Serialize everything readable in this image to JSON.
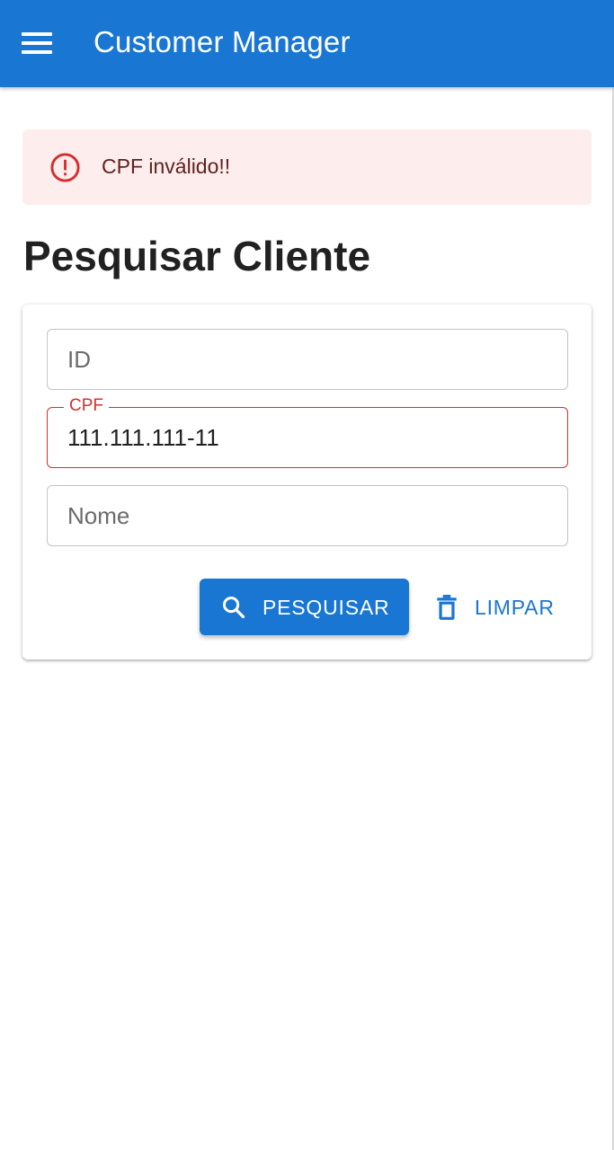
{
  "appbar": {
    "title": "Customer Manager",
    "menu_icon": "menu-icon",
    "color": "#1976d2"
  },
  "alert": {
    "severity": "error",
    "icon": "error-outline-icon",
    "message": "CPF inválido!!",
    "background": "#fdeded",
    "icon_color": "#d32f2f"
  },
  "page": {
    "title": "Pesquisar Cliente"
  },
  "form": {
    "id_field": {
      "placeholder": "ID",
      "value": ""
    },
    "cpf_field": {
      "label": "CPF",
      "value": "111.111.111-11",
      "state": "error"
    },
    "name_field": {
      "placeholder": "Nome",
      "value": ""
    },
    "search_button": {
      "label": "PESQUISAR",
      "icon": "search-icon"
    },
    "clear_button": {
      "label": "LIMPAR",
      "icon": "trash-icon"
    }
  }
}
